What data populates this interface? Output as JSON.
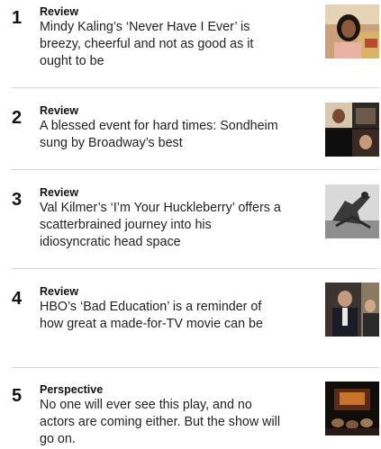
{
  "articles": [
    {
      "rank": "1",
      "kicker": "Review",
      "headline": "Mindy Kaling’s ‘Never Have I Ever’ is breezy, cheerful and not as good as it ought to be"
    },
    {
      "rank": "2",
      "kicker": "Review",
      "headline": "A blessed event for hard times: Sondheim sung by Broadway’s best"
    },
    {
      "rank": "3",
      "kicker": "Review",
      "headline": "Val Kilmer’s ‘I’m Your Huckleberry’ offers a scatterbrained journey into his idiosyncratic head space"
    },
    {
      "rank": "4",
      "kicker": "Review",
      "headline": "HBO’s ‘Bad Education’ is a reminder of how great a made-for-TV movie can be"
    },
    {
      "rank": "5",
      "kicker": "Perspective",
      "headline": "No one will ever see this play, and no actors are coming either. But the show will go on."
    }
  ]
}
